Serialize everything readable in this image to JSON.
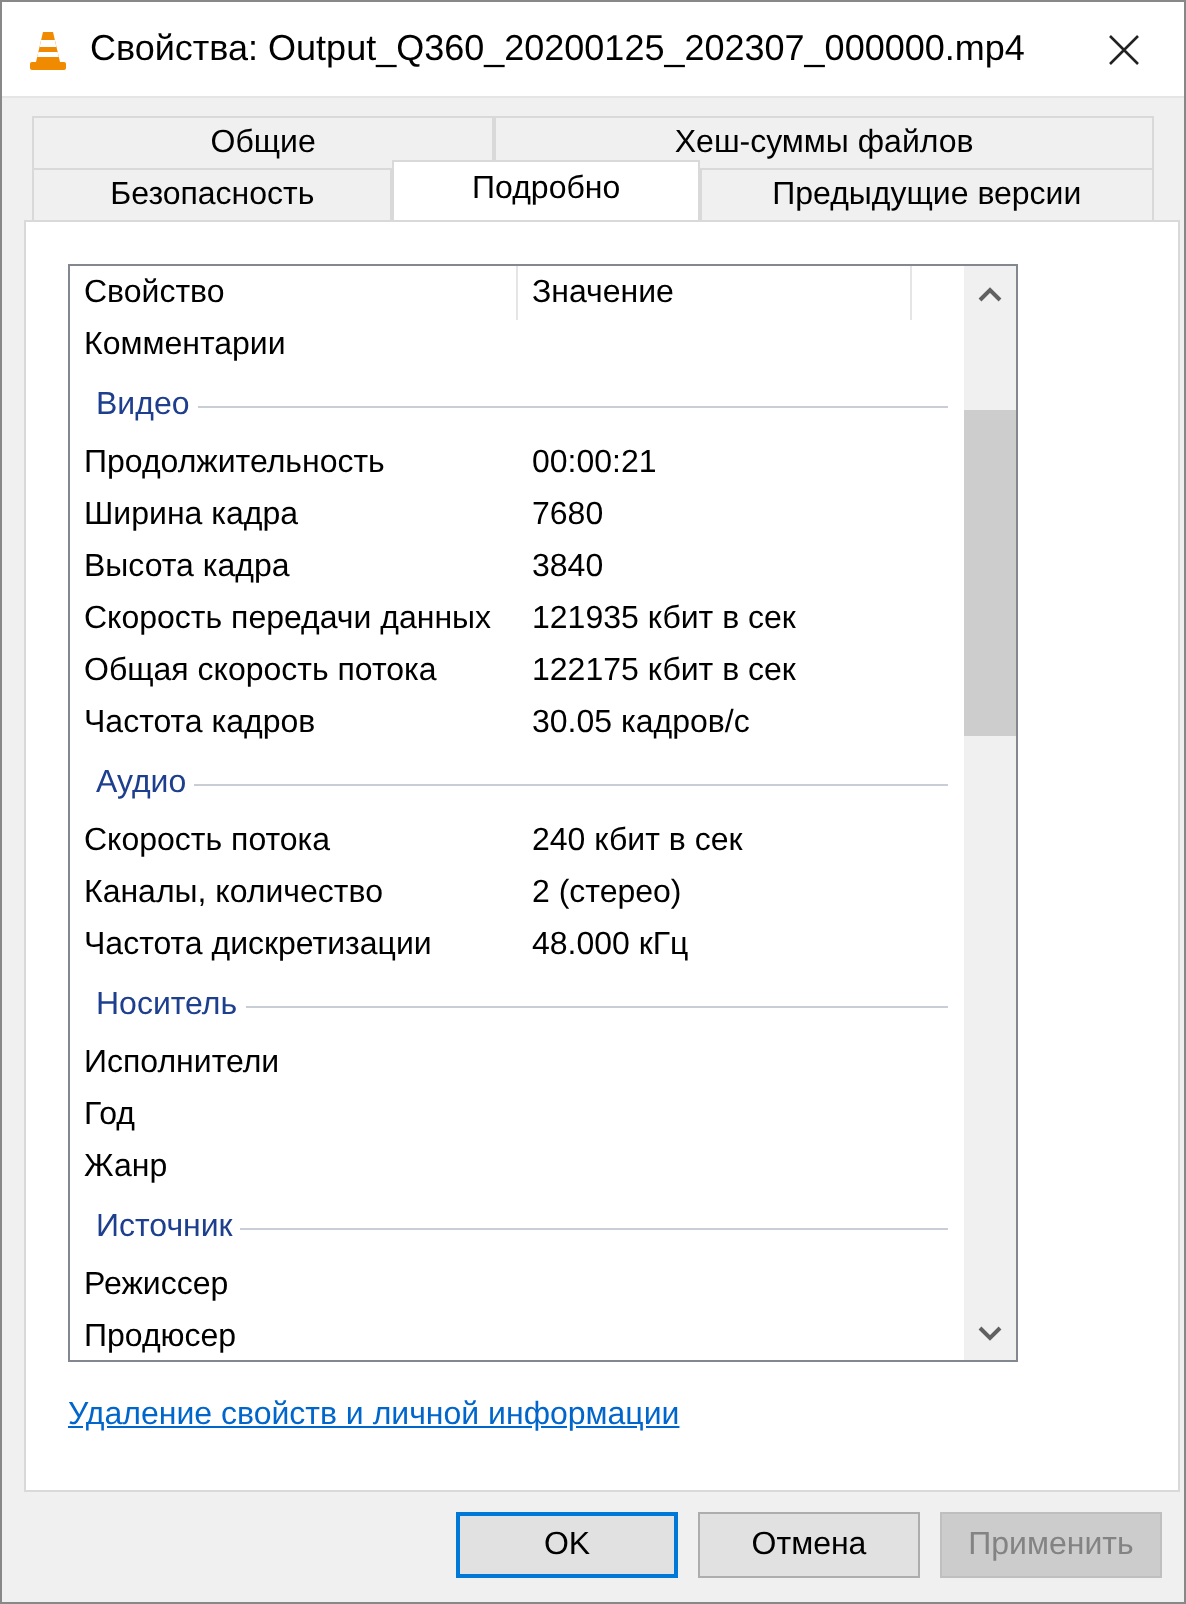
{
  "window": {
    "title": "Свойства: Output_Q360_20200125_202307_000000.mp4"
  },
  "tab_rows": [
    [
      {
        "label": "Общие",
        "selected": false
      },
      {
        "label": "Хеш-суммы файлов",
        "selected": false
      }
    ],
    [
      {
        "label": "Безопасность",
        "selected": false
      },
      {
        "label": "Подробно",
        "selected": true
      },
      {
        "label": "Предыдущие версии",
        "selected": false
      }
    ]
  ],
  "list": {
    "columns": [
      "Свойство",
      "Значение"
    ],
    "rows": [
      {
        "kind": "property",
        "name": "Комментарии"
      },
      {
        "kind": "group",
        "name": "Видео"
      },
      {
        "kind": "property",
        "name": "Продолжительность",
        "value": "00:00:21"
      },
      {
        "kind": "property",
        "name": "Ширина кадра",
        "value": "7680"
      },
      {
        "kind": "property",
        "name": "Высота кадра",
        "value": "3840"
      },
      {
        "kind": "property",
        "name": "Скорость передачи данных",
        "value": "121935 кбит в сек"
      },
      {
        "kind": "property",
        "name": "Общая скорость потока",
        "value": "122175 кбит в сек"
      },
      {
        "kind": "property",
        "name": "Частота кадров",
        "value": "30.05 кадров/с"
      },
      {
        "kind": "group",
        "name": "Аудио"
      },
      {
        "kind": "property",
        "name": "Скорость потока",
        "value": "240 кбит в сек"
      },
      {
        "kind": "property",
        "name": "Каналы, количество",
        "value": "2 (стерео)"
      },
      {
        "kind": "property",
        "name": "Частота дискретизации",
        "value": "48.000 кГц"
      },
      {
        "kind": "group",
        "name": "Носитель"
      },
      {
        "kind": "property",
        "name": "Исполнители"
      },
      {
        "kind": "property",
        "name": "Год"
      },
      {
        "kind": "property",
        "name": "Жанр"
      },
      {
        "kind": "group",
        "name": "Источник"
      },
      {
        "kind": "property",
        "name": "Режиссер"
      },
      {
        "kind": "property",
        "name": "Продюсер"
      }
    ]
  },
  "link": "Удаление свойств и личной информации",
  "buttons": [
    {
      "label": "OK",
      "default": true,
      "disabled": false
    },
    {
      "label": "Отмена",
      "default": false,
      "disabled": false
    },
    {
      "label": "Применить",
      "default": false,
      "disabled": true
    }
  ]
}
